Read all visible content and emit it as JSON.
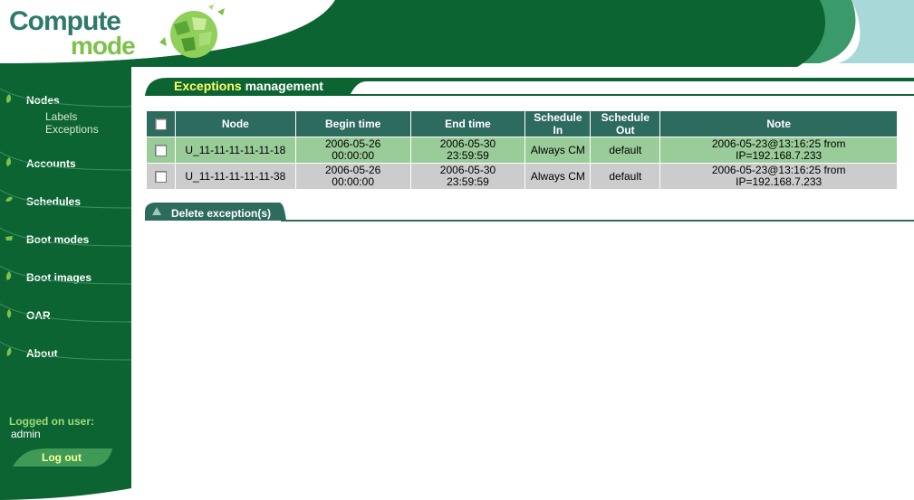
{
  "logo": {
    "line1": "Compute",
    "line2": "mode"
  },
  "colors": {
    "dark_green": "#0d6433",
    "accent_green": "#7cc14a",
    "table_header": "#2e6b5f",
    "row_selected": "#99cc99",
    "row_default": "#cccccc",
    "title_accent": "#ffff66"
  },
  "sidebar": {
    "items": [
      {
        "label": "Nodes",
        "icon": "leaf-icon"
      },
      {
        "label": "Accounts",
        "icon": "leaf-icon"
      },
      {
        "label": "Schedules",
        "icon": "leaf-icon"
      },
      {
        "label": "Boot modes",
        "icon": "leaf-icon"
      },
      {
        "label": "Boot images",
        "icon": "leaf-icon"
      },
      {
        "label": "OAR",
        "icon": "leaf-icon"
      },
      {
        "label": "About",
        "icon": "leaf-icon"
      }
    ],
    "subitems": [
      {
        "label": "Labels"
      },
      {
        "label": "Exceptions"
      }
    ],
    "logged_label": "Logged on user:",
    "user": "admin",
    "logout_label": "Log out"
  },
  "page": {
    "title_accent": "Exceptions",
    "title_rest": " management"
  },
  "table": {
    "columns": [
      "Node",
      "Begin time",
      "End time",
      "Schedule In",
      "Schedule Out",
      "Note"
    ],
    "rows": [
      {
        "node": "U_11-11-11-11-11-18",
        "begin_date": "2006-05-26",
        "begin_time": "00:00:00",
        "end_date": "2006-05-30",
        "end_time": "23:59:59",
        "schedule_in": "Always CM",
        "schedule_out": "default",
        "note_line1": "2006-05-23@13:16:25 from",
        "note_line2": "IP=192.168.7.233"
      },
      {
        "node": "U_11-11-11-11-11-38",
        "begin_date": "2006-05-26",
        "begin_time": "00:00:00",
        "end_date": "2006-05-30",
        "end_time": "23:59:59",
        "schedule_in": "Always CM",
        "schedule_out": "default",
        "note_line1": "2006-05-23@13:16:25 from",
        "note_line2": "IP=192.168.7.233"
      }
    ]
  },
  "actions": {
    "delete_label": "Delete exception(s)"
  }
}
